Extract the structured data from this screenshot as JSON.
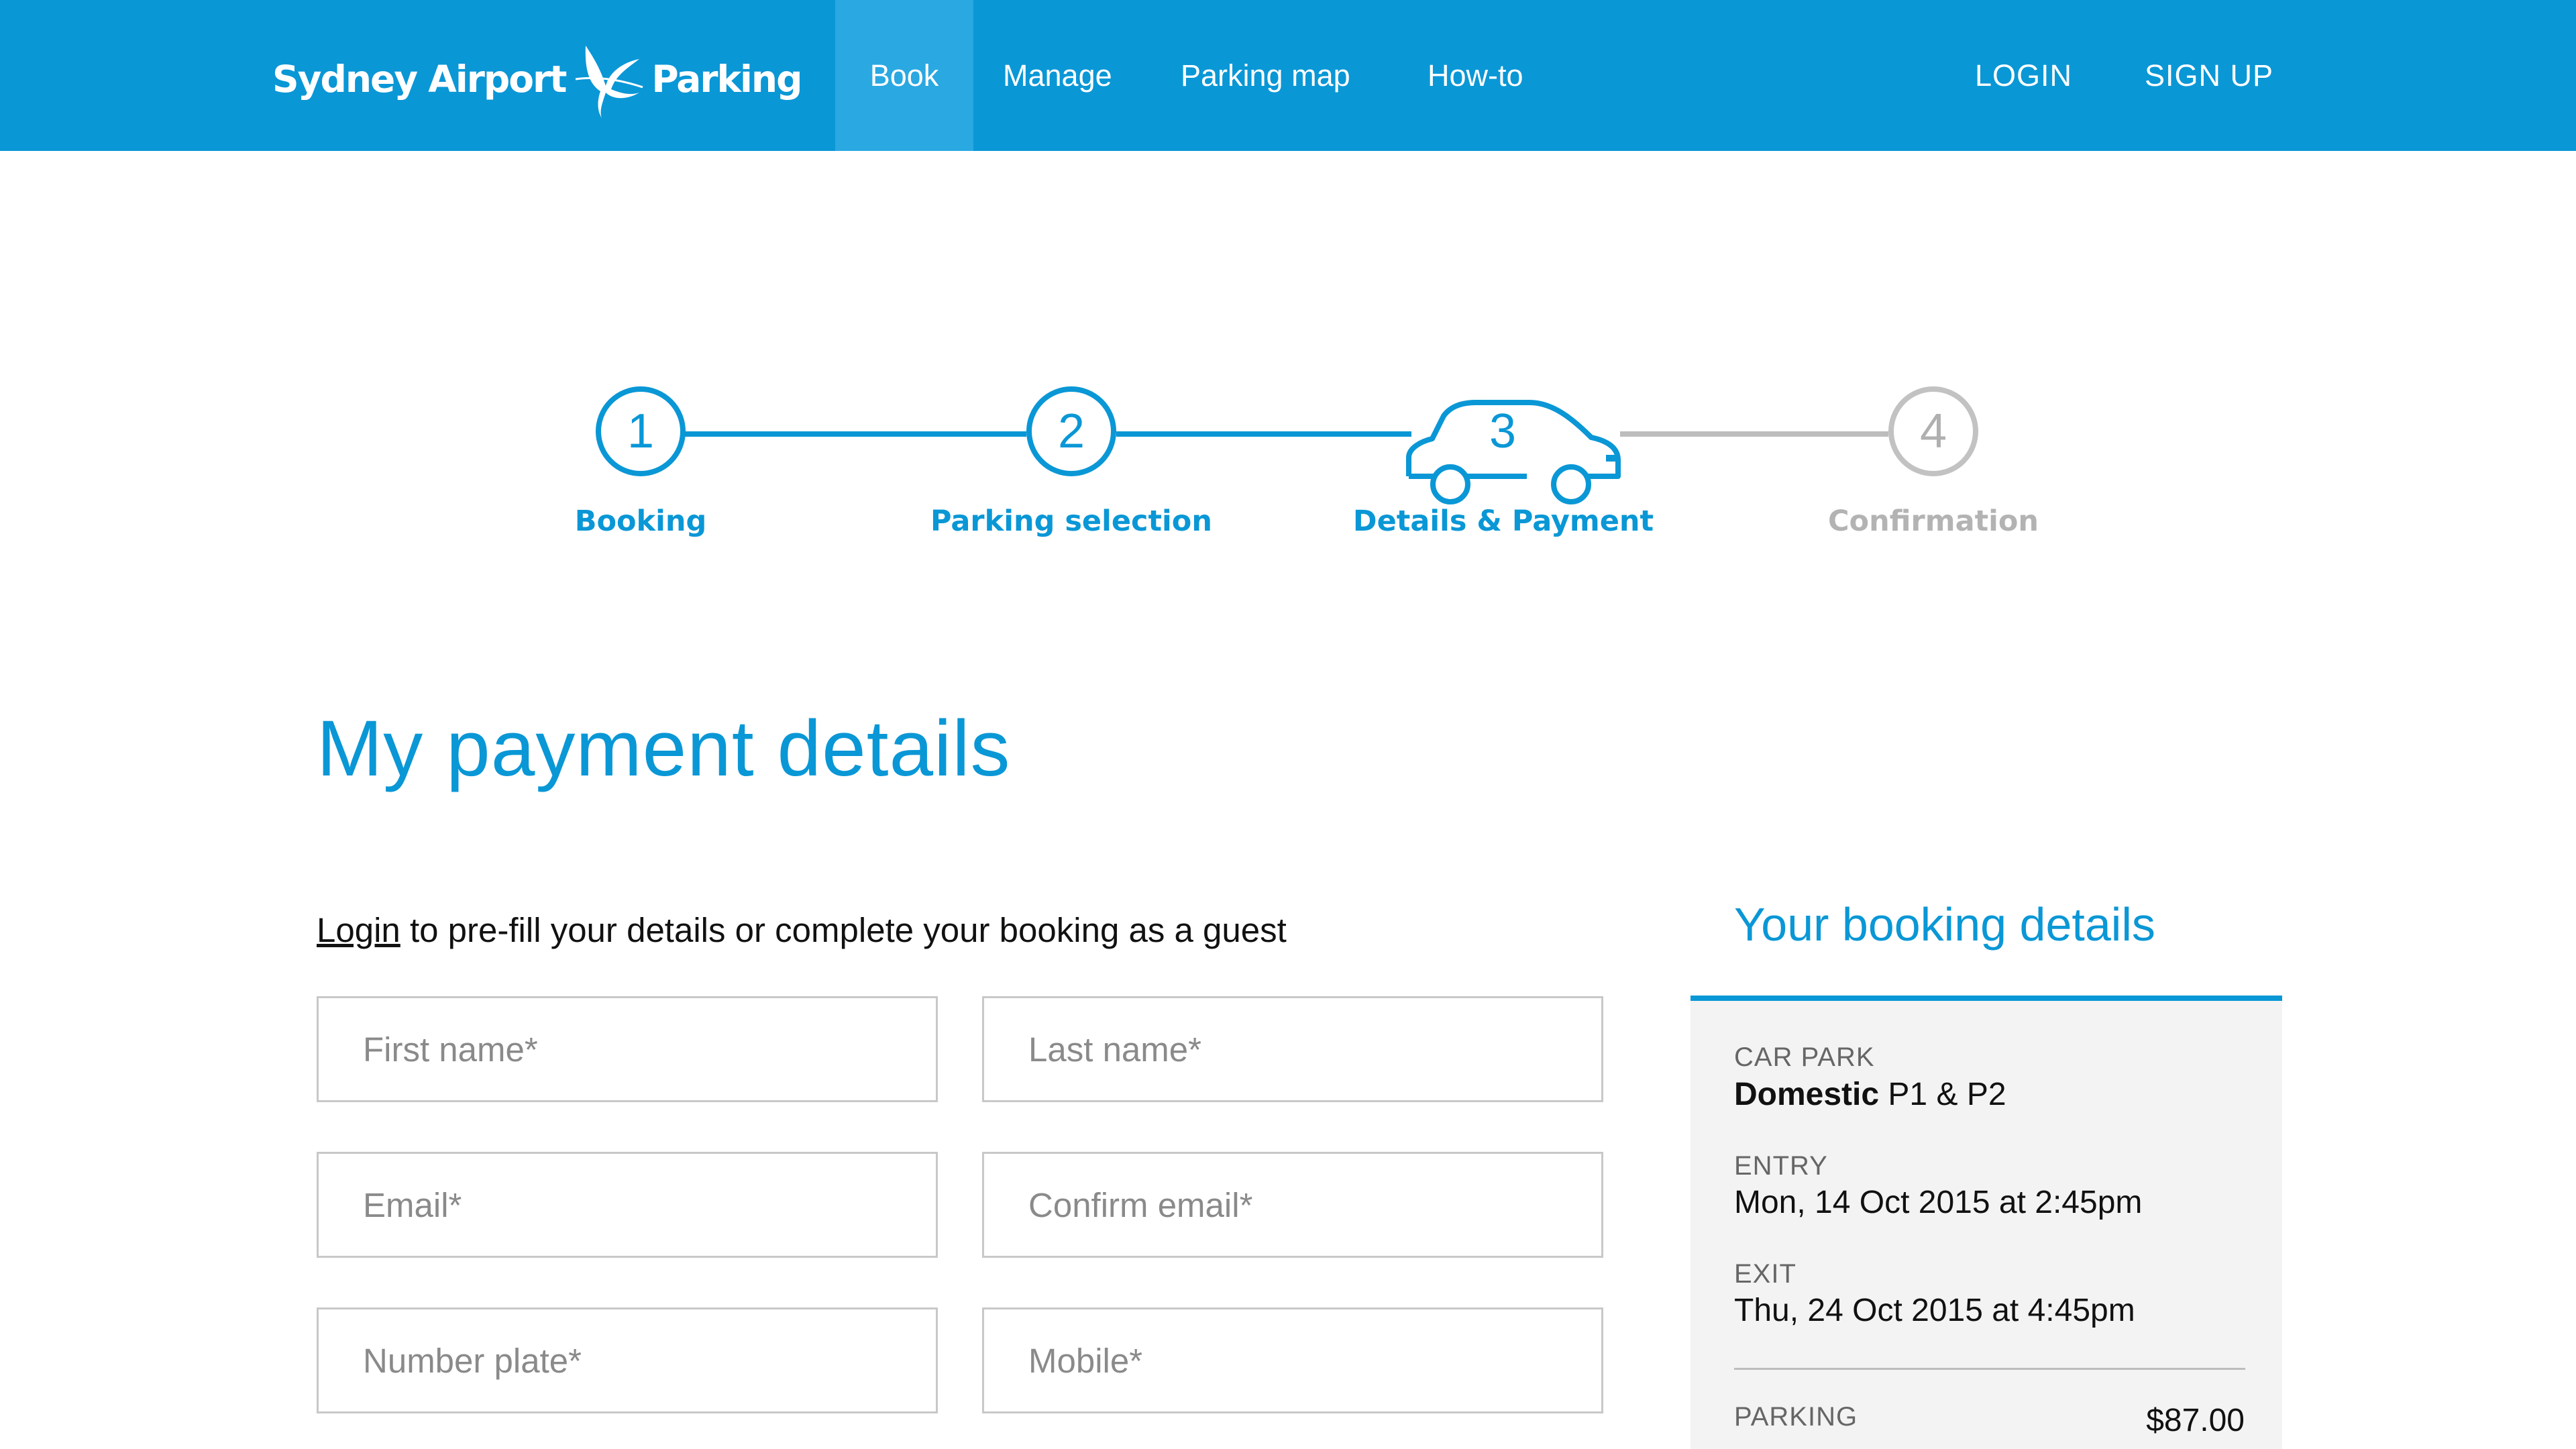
{
  "header": {
    "logo_text_left": "Sydney Airport",
    "logo_text_right": "Parking",
    "nav": [
      "Book",
      "Manage",
      "Parking map",
      "How-to"
    ],
    "login": "LOGIN",
    "signup": "SIGN UP",
    "bg_color": "#0a97d6",
    "active_color": "#2aa8e2"
  },
  "steps": [
    {
      "number": "1",
      "label": "Booking",
      "state": "complete"
    },
    {
      "number": "2",
      "label": "Parking selection",
      "state": "complete"
    },
    {
      "number": "3",
      "label": "Details & Payment",
      "state": "current"
    },
    {
      "number": "4",
      "label": "Confirmation",
      "state": "upcoming"
    }
  ],
  "main": {
    "title": "My payment details",
    "login_link": "Login",
    "login_text": " to pre-fill your details or complete your booking as a guest",
    "fields": {
      "first_name": "First name*",
      "last_name": "Last name*",
      "email": "Email*",
      "confirm_email": "Confirm email*",
      "number_plate": "Number plate*",
      "mobile": "Mobile*"
    }
  },
  "summary": {
    "title": "Your booking details",
    "car_park_label": "CAR PARK",
    "car_park_bold": "Domestic",
    "car_park_rest": " P1 & P2",
    "entry_label": "ENTRY",
    "entry_value": "Mon, 14 Oct 2015 at 2:45pm",
    "exit_label": "EXIT",
    "exit_value": "Thu, 24 Oct 2015 at 4:45pm",
    "parking_label": "PARKING",
    "parking_price": "$87.00"
  },
  "colors": {
    "accent": "#0a97d6",
    "inactive": "#bdbdbd",
    "panel": "#f3f3f3"
  }
}
